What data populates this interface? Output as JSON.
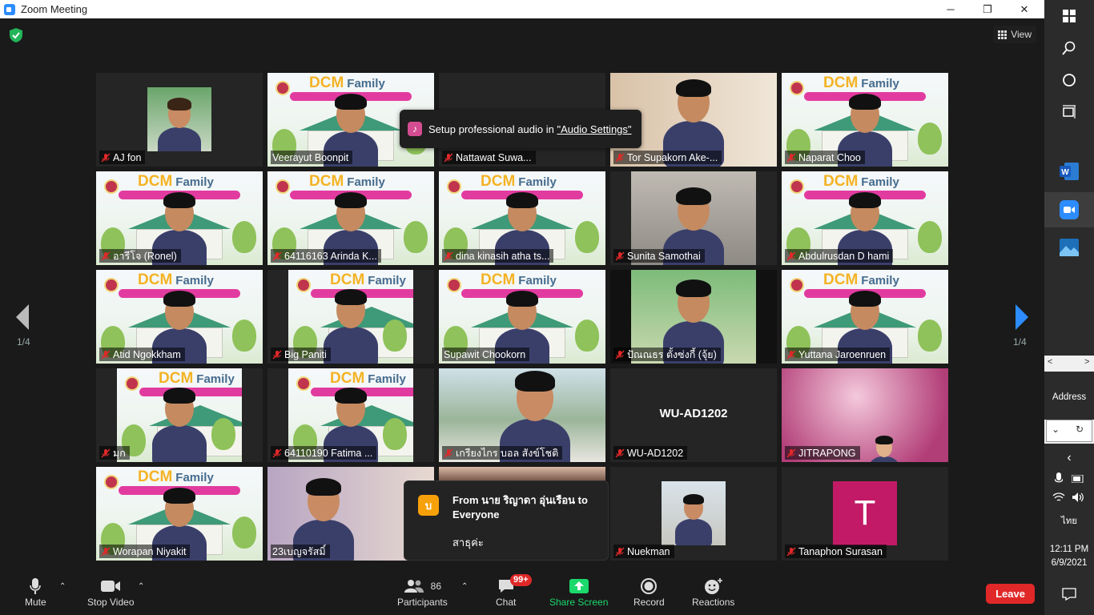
{
  "window": {
    "title": "Zoom Meeting",
    "minimize": "─",
    "maximize": "❐",
    "close": "✕"
  },
  "header": {
    "view_label": "View"
  },
  "pagination": {
    "left": "1/4",
    "right": "1/4"
  },
  "colors": {
    "active_speaker": "#c9e64a",
    "leave": "#e02828",
    "share": "#1bd96b",
    "zoom_blue": "#2d8cff"
  },
  "tiles": [
    {
      "name": "AJ fon"
    },
    {
      "name": "Veerayut Boonpit"
    },
    {
      "name": "Nattawat  Suwa..."
    },
    {
      "name": "Tor Supakorn Ake-..."
    },
    {
      "name": "Naparat Choo"
    },
    {
      "name": "อารีโจ (Ronel)"
    },
    {
      "name": "64116163 Arinda K..."
    },
    {
      "name": "dina kinasih atha ts..."
    },
    {
      "name": "Sunita Samothai"
    },
    {
      "name": "Abdulrusdan D hami"
    },
    {
      "name": "Atid Ngokkham"
    },
    {
      "name": "Big Paniti"
    },
    {
      "name": "Supawit Chookorn"
    },
    {
      "name": "ปัณณธร ตั้งซ่งกี้ (จุ้ย)"
    },
    {
      "name": "Yuttana Jaroenruen"
    },
    {
      "name": "มุก"
    },
    {
      "name": "64110190 Fatima ..."
    },
    {
      "name": "เกรียงไกร บอล สังข์โชติ"
    },
    {
      "name": "WU-AD1202"
    },
    {
      "name": "JITRAPONG"
    },
    {
      "name": "Worapan Niyakit"
    },
    {
      "name": "23เบญจรัสมิ์"
    },
    {
      "name": ""
    },
    {
      "name": "Nuekman"
    },
    {
      "name": "Tanaphon Surasan"
    }
  ],
  "dcm": {
    "title": "DCM",
    "family": "Family"
  },
  "avatar_letter": "T",
  "audio_toast": {
    "text": "Setup professional audio in ",
    "link": "\"Audio Settings\"",
    "icon": "music-note-icon"
  },
  "chat_popup": {
    "badge": "บ",
    "from": "From นาย ริญาดา อุ่นเรือน to Everyone",
    "message": "สาธุค่ะ"
  },
  "toolbar": {
    "mute": "Mute",
    "stop_video": "Stop Video",
    "participants": "Participants",
    "participants_count": "86",
    "chat": "Chat",
    "chat_badge": "99+",
    "share_screen": "Share Screen",
    "record": "Record",
    "reactions": "Reactions",
    "leave": "Leave"
  },
  "taskbar": {
    "address": "Address",
    "time": "12:11 PM",
    "date": "6/9/2021",
    "language": "ไทย"
  }
}
